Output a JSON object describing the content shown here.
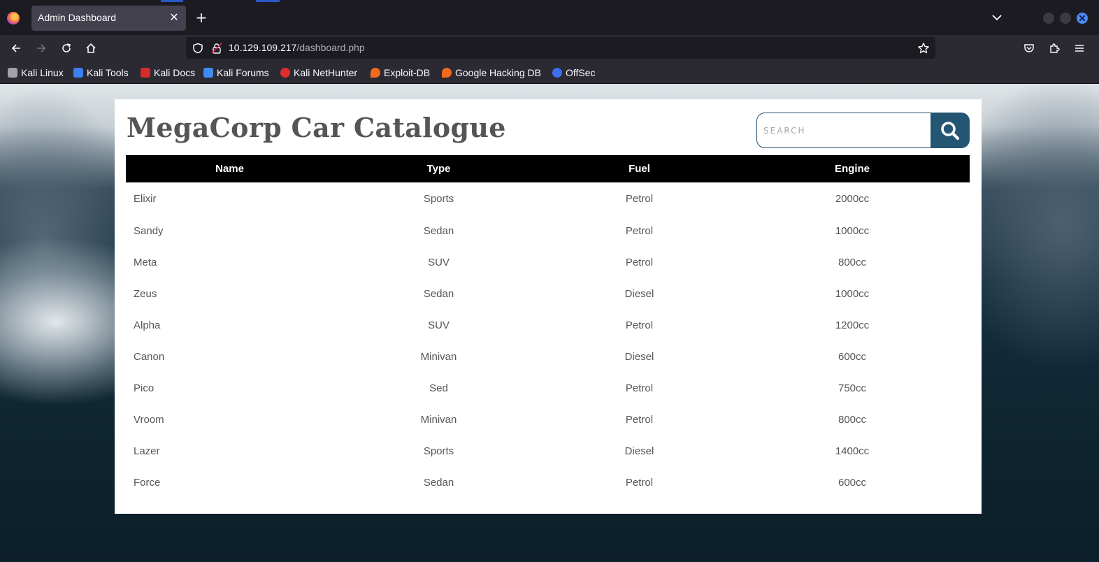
{
  "browser": {
    "tab_title": "Admin Dashboard",
    "url_host": "10.129.109.217",
    "url_path": "/dashboard.php",
    "bookmarks": [
      {
        "label": "Kali Linux",
        "icon": "kali-dragon-icon",
        "color": "#9fa3a8"
      },
      {
        "label": "Kali Tools",
        "icon": "kali-tools-icon",
        "color": "#3d7ff2"
      },
      {
        "label": "Kali Docs",
        "icon": "kali-docs-icon",
        "color": "#d62b2b"
      },
      {
        "label": "Kali Forums",
        "icon": "kali-forums-icon",
        "color": "#3f8bf0"
      },
      {
        "label": "Kali NetHunter",
        "icon": "kali-nethunter-icon",
        "color": "#e02d2d"
      },
      {
        "label": "Exploit-DB",
        "icon": "exploit-db-icon",
        "color": "#f26b1d"
      },
      {
        "label": "Google Hacking DB",
        "icon": "ghdb-icon",
        "color": "#f26b1d"
      },
      {
        "label": "OffSec",
        "icon": "offsec-icon",
        "color": "#3b6ff2"
      }
    ]
  },
  "page": {
    "title": "MegaCorp Car Catalogue",
    "search_placeholder": "SEARCH",
    "accent_color": "#245674"
  },
  "table": {
    "headers": [
      "Name",
      "Type",
      "Fuel",
      "Engine"
    ],
    "rows": [
      [
        "Elixir",
        "Sports",
        "Petrol",
        "2000cc"
      ],
      [
        "Sandy",
        "Sedan",
        "Petrol",
        "1000cc"
      ],
      [
        "Meta",
        "SUV",
        "Petrol",
        "800cc"
      ],
      [
        "Zeus",
        "Sedan",
        "Diesel",
        "1000cc"
      ],
      [
        "Alpha",
        "SUV",
        "Petrol",
        "1200cc"
      ],
      [
        "Canon",
        "Minivan",
        "Diesel",
        "600cc"
      ],
      [
        "Pico",
        "Sed",
        "Petrol",
        "750cc"
      ],
      [
        "Vroom",
        "Minivan",
        "Petrol",
        "800cc"
      ],
      [
        "Lazer",
        "Sports",
        "Diesel",
        "1400cc"
      ],
      [
        "Force",
        "Sedan",
        "Petrol",
        "600cc"
      ]
    ]
  }
}
